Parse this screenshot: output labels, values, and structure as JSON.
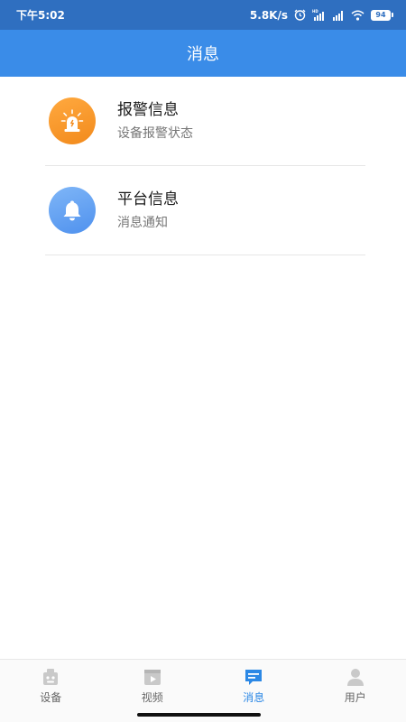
{
  "status_bar": {
    "time": "下午5:02",
    "network_speed": "5.8K/s",
    "battery": "94",
    "icons": [
      "alarm-icon",
      "hd-signal-icon",
      "signal-icon",
      "wifi-icon",
      "battery-icon"
    ]
  },
  "header": {
    "title": "消息"
  },
  "messages": [
    {
      "title": "报警信息",
      "subtitle": "设备报警状态",
      "icon": "alarm-light-icon",
      "color": "#f5961f"
    },
    {
      "title": "平台信息",
      "subtitle": "消息通知",
      "icon": "bell-icon",
      "color": "#5a9bf0"
    }
  ],
  "bottom_nav": {
    "items": [
      {
        "label": "设备",
        "icon": "device-icon",
        "active": false
      },
      {
        "label": "视频",
        "icon": "video-icon",
        "active": false
      },
      {
        "label": "消息",
        "icon": "message-icon",
        "active": true
      },
      {
        "label": "用户",
        "icon": "user-icon",
        "active": false
      }
    ]
  },
  "colors": {
    "status_bar": "#2f6fc0",
    "header": "#3a8ce8",
    "active": "#2c88e5"
  }
}
